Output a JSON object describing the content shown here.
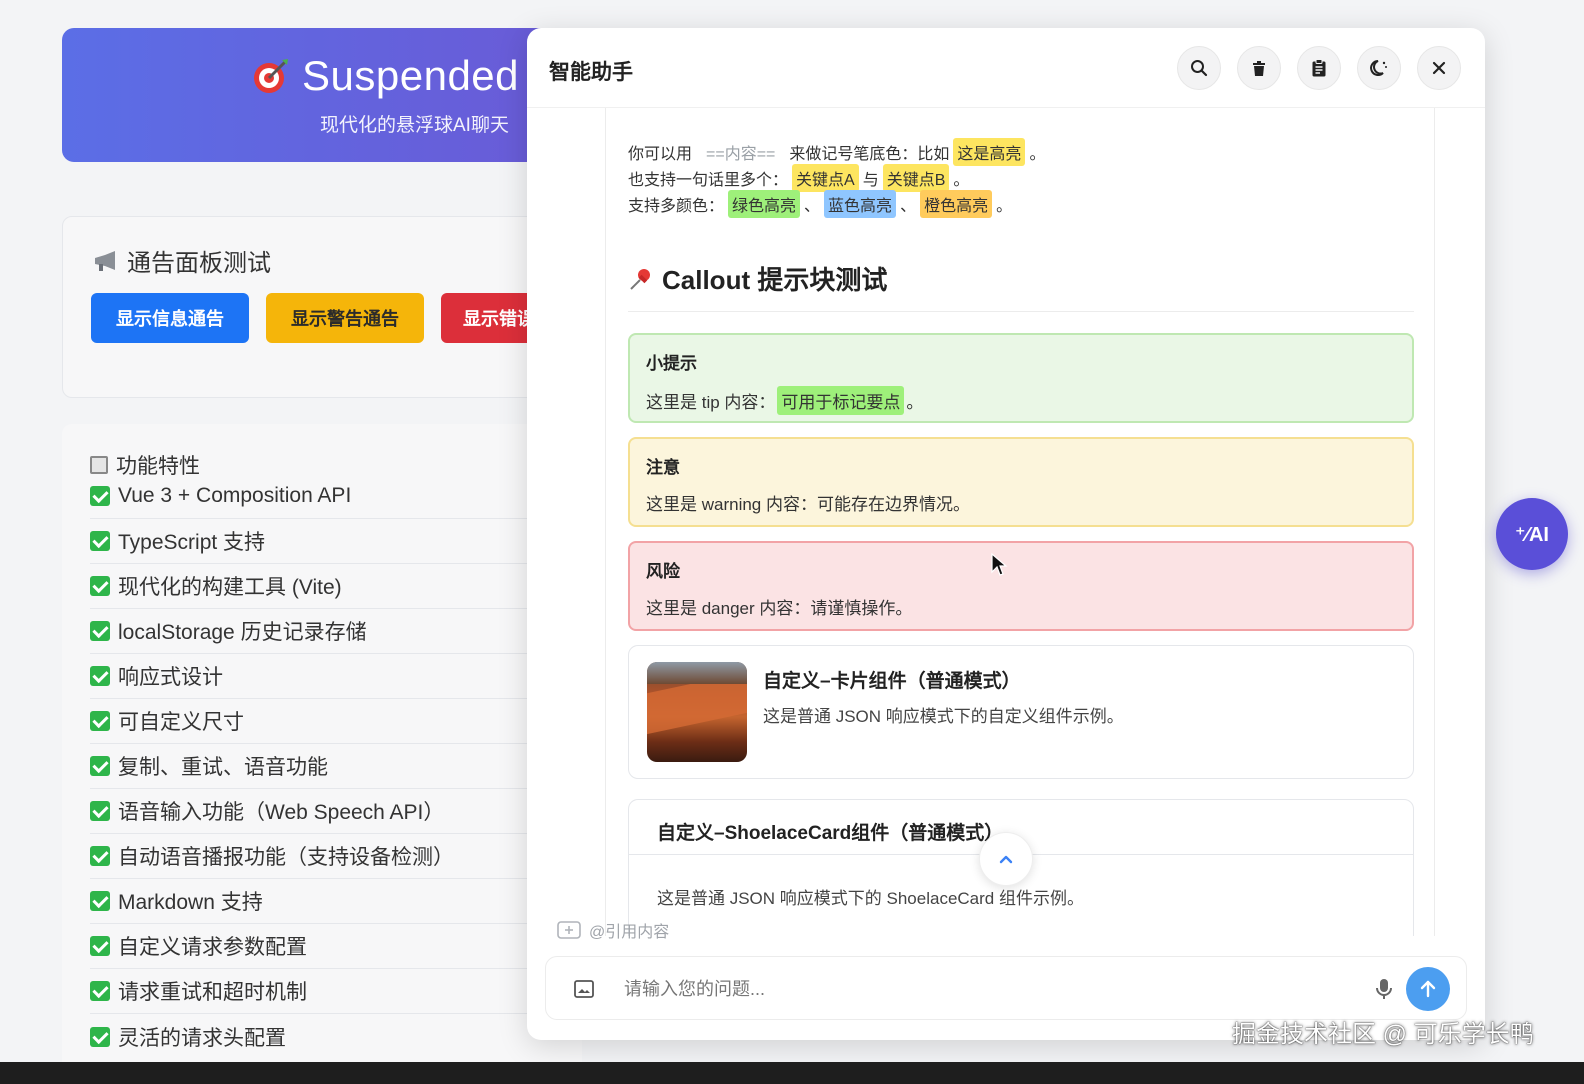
{
  "banner": {
    "title": "Suspended",
    "subtitle": "现代化的悬浮球AI聊天",
    "target_icon": "target-icon"
  },
  "notice_panel": {
    "title": "通告面板测试",
    "buttons": {
      "info": "显示信息通告",
      "warning": "显示警告通告",
      "error": "显示错误通告"
    }
  },
  "features": {
    "heading": "功能特性",
    "items": [
      "Vue 3 + Composition API",
      "TypeScript 支持",
      "现代化的构建工具 (Vite)",
      "localStorage 历史记录存储",
      "响应式设计",
      "可自定义尺寸",
      "复制、重试、语音功能",
      "语音输入功能（Web Speech API）",
      "自动语音播报功能（支持设备检测）",
      "Markdown 支持",
      "自定义请求参数配置",
      "请求重试和超时机制",
      "灵活的请求头配置"
    ]
  },
  "chat": {
    "title": "智能助手",
    "header_icons": [
      "search-icon",
      "trash-icon",
      "clipboard-icon",
      "moon-icon",
      "close-icon"
    ],
    "highlight_lines": {
      "line1": {
        "prefix": "你可以用",
        "syntax": "==内容==",
        "middle": "来做记号笔底色：比如",
        "hl": "这是高亮",
        "end": "。"
      },
      "line2": {
        "prefix": "也支持一句话里多个：",
        "hl1": "关键点A",
        "mid": "与",
        "hl2": "关键点B",
        "end": "。"
      },
      "line3": {
        "prefix": "支持多颜色：",
        "hl1": "绿色高亮",
        "sep1": "、",
        "hl2": "蓝色高亮",
        "sep2": "、",
        "hl3": "橙色高亮",
        "end": "。"
      }
    },
    "section_title": "Callout 提示块测试",
    "callouts": {
      "tip": {
        "title": "小提示",
        "text": "这里是 tip 内容：",
        "hl": "可用于标记要点",
        "end": "。"
      },
      "warning": {
        "title": "注意",
        "text": "这里是 warning 内容：可能存在边界情况。"
      },
      "danger": {
        "title": "风险",
        "text": "这里是 danger 内容：请谨慎操作。"
      }
    },
    "card": {
      "title": "自定义–卡片组件（普通模式）",
      "desc": "这是普通 JSON 响应模式下的自定义组件示例。"
    },
    "shoelace_card": {
      "title": "自定义–ShoelaceCard组件（普通模式）",
      "desc": "这是普通 JSON 响应模式下的 ShoelaceCard 组件示例。"
    },
    "quote_label": "@引用内容",
    "input": {
      "placeholder": "请输入您的问题...",
      "value": ""
    }
  },
  "ai_ball": {
    "label": "⁺⁄AI"
  },
  "watermark": "掘金技术社区 @ 可乐学长鸭",
  "colors": {
    "primary": "#1d74f5",
    "warning": "#f5b50a",
    "danger": "#dc2f3a",
    "accent": "#5a4fd8"
  }
}
